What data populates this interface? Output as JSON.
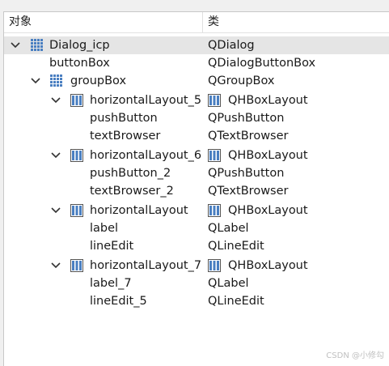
{
  "header": {
    "object_label": "对象",
    "class_label": "类"
  },
  "rows": [
    {
      "name": "Dialog_icp",
      "cls": "QDialog",
      "icon": "grid-layout-icon",
      "selected": true
    },
    {
      "name": "buttonBox",
      "cls": "QDialogButtonBox"
    },
    {
      "name": "groupBox",
      "cls": "QGroupBox",
      "icon": "grid-layout-icon"
    },
    {
      "name": "horizontalLayout_5",
      "cls": "QHBoxLayout",
      "icon": "hbox-layout-icon"
    },
    {
      "name": "pushButton",
      "cls": "QPushButton"
    },
    {
      "name": "textBrowser",
      "cls": "QTextBrowser"
    },
    {
      "name": "horizontalLayout_6",
      "cls": "QHBoxLayout",
      "icon": "hbox-layout-icon"
    },
    {
      "name": "pushButton_2",
      "cls": "QPushButton"
    },
    {
      "name": "textBrowser_2",
      "cls": "QTextBrowser"
    },
    {
      "name": "horizontalLayout",
      "cls": "QHBoxLayout",
      "icon": "hbox-layout-icon"
    },
    {
      "name": "label",
      "cls": "QLabel"
    },
    {
      "name": "lineEdit",
      "cls": "QLineEdit"
    },
    {
      "name": "horizontalLayout_7",
      "cls": "QHBoxLayout",
      "icon": "hbox-layout-icon"
    },
    {
      "name": "label_7",
      "cls": "QLabel"
    },
    {
      "name": "lineEdit_5",
      "cls": "QLineEdit"
    }
  ],
  "watermark": "CSDN @小修勾",
  "colors": {
    "selected_row": "#e5e5e5",
    "icon_blue": "#4a7fc1"
  }
}
